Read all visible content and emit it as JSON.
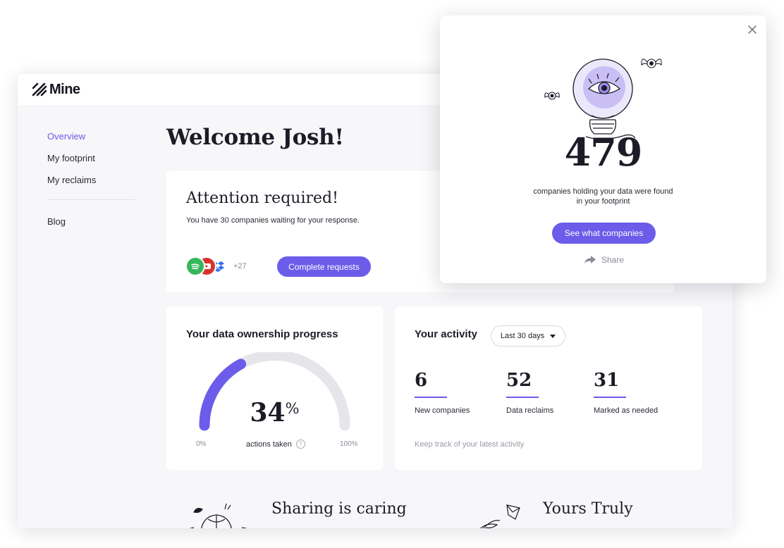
{
  "app": {
    "brand": "Mine"
  },
  "sidebar": {
    "items": [
      {
        "label": "Overview"
      },
      {
        "label": "My footprint"
      },
      {
        "label": "My reclaims"
      },
      {
        "label": "Blog"
      }
    ]
  },
  "main": {
    "welcome": "Welcome Josh!",
    "attention": {
      "title": "Attention required!",
      "subtitle": "You have 30 companies waiting for your response.",
      "more_count": "+27",
      "button": "Complete requests",
      "company_icons": [
        "spotify-icon",
        "youtube-icon",
        "dropbox-icon"
      ]
    },
    "progress": {
      "title": "Your data ownership progress",
      "value": "34",
      "unit": "%",
      "fraction": 0.34,
      "caption": "actions taken",
      "min_label": "0%",
      "max_label": "100%"
    },
    "activity": {
      "title": "Your activity",
      "range": "Last 30 days",
      "stats": [
        {
          "value": "6",
          "label": "New companies"
        },
        {
          "value": "52",
          "label": "Data reclaims"
        },
        {
          "value": "31",
          "label": "Marked as needed"
        }
      ],
      "note": "Keep track of your latest activity"
    },
    "promos": [
      {
        "title": "Sharing is caring"
      },
      {
        "title": "Yours Truly"
      }
    ]
  },
  "popup": {
    "count": "479",
    "text": "companies holding your data were found in your footprint",
    "button": "See what companies",
    "share": "Share"
  },
  "colors": {
    "accent": "#6b5cea",
    "track": "#e6e6ea"
  }
}
